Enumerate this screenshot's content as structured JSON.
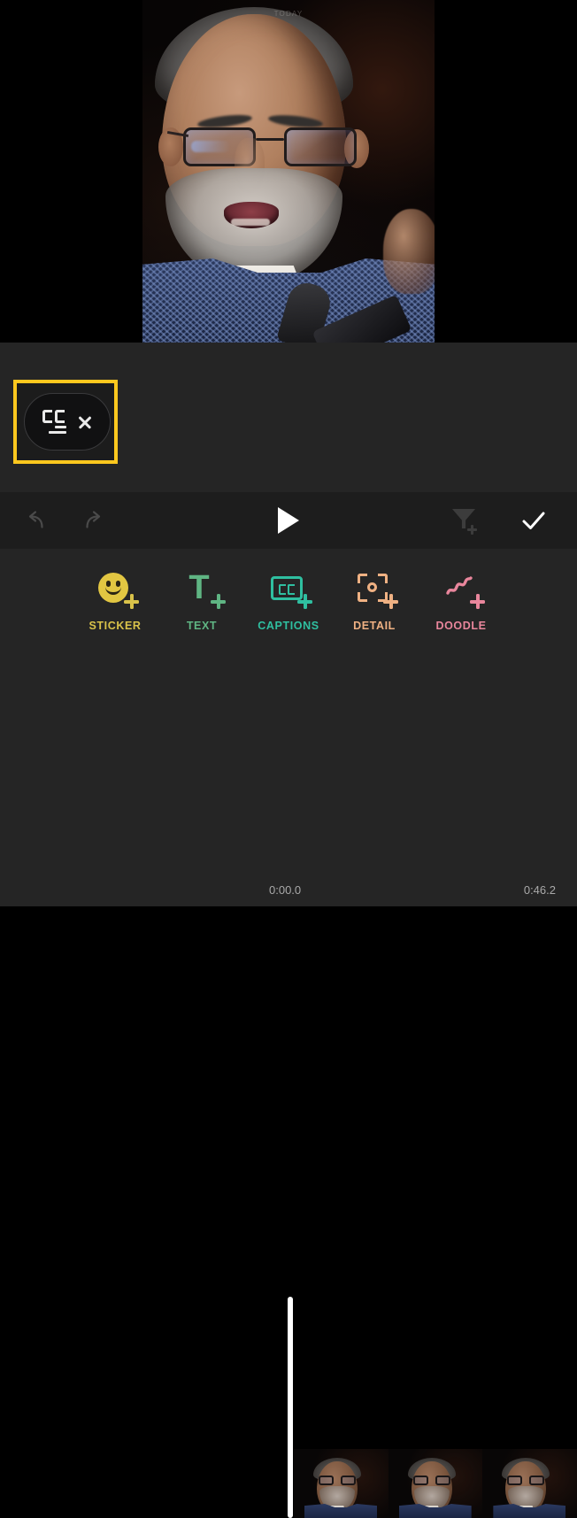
{
  "app": {
    "background_color": "#252525",
    "control_bar_color": "#1d1d1d"
  },
  "preview": {
    "overlay_label": "TODAY",
    "subject_description": "man with glasses and gray beard speaking into a microphone"
  },
  "caption_chip": {
    "highlight_color": "#ffc81e",
    "icon": "closed-captions-icon",
    "close_icon": "close-x-icon",
    "chip_background": "#111112"
  },
  "controls": {
    "undo": {
      "label": "Undo",
      "icon": "undo-arrow-icon",
      "enabled": false
    },
    "redo": {
      "label": "Redo",
      "icon": "redo-arrow-icon",
      "enabled": false
    },
    "play": {
      "label": "Play",
      "icon": "play-triangle-icon",
      "enabled": true
    },
    "filter": {
      "label": "Add Filter",
      "icon": "funnel-plus-icon",
      "enabled": false
    },
    "confirm": {
      "label": "Done",
      "icon": "checkmark-icon",
      "enabled": true
    }
  },
  "toolbar": {
    "items": [
      {
        "label": "STICKER",
        "icon": "sticker-smiley-plus-icon",
        "color": "#d9c24a",
        "selected": false
      },
      {
        "label": "TEXT",
        "icon": "text-t-plus-icon",
        "color": "#5fb583",
        "selected": false
      },
      {
        "label": "CAPTIONS",
        "icon": "captions-cc-plus-icon",
        "color": "#2fbfa0",
        "selected": true
      },
      {
        "label": "DETAIL",
        "icon": "detail-focus-plus-icon",
        "color": "#efb183",
        "selected": false
      },
      {
        "label": "DOODLE",
        "icon": "doodle-squiggle-plus-icon",
        "color": "#e9869c",
        "selected": false
      }
    ]
  },
  "timeline": {
    "playhead_color": "#ffffff",
    "start_time": "0:00.0",
    "end_time": "0:46.2",
    "thumbnail_count": 3
  }
}
